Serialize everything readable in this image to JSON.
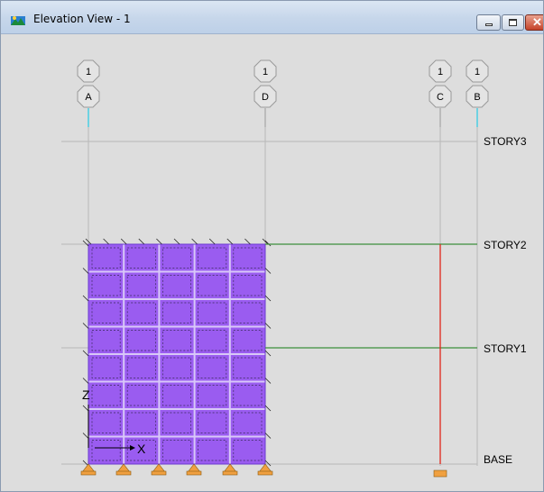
{
  "window": {
    "title": "Elevation View - 1",
    "controls": {
      "minimize": "minimize",
      "maximize": "maximize",
      "close": "close"
    }
  },
  "elevation": {
    "grids": [
      {
        "number": "1",
        "letter": "A"
      },
      {
        "number": "1",
        "letter": "D"
      },
      {
        "number": "1",
        "letter": "C"
      },
      {
        "number": "1",
        "letter": "B"
      }
    ],
    "stories": [
      "STORY3",
      "STORY2",
      "STORY1",
      "BASE"
    ],
    "axes": {
      "vertical": "Z",
      "horizontal": "X"
    },
    "colors": {
      "wall": "#9a5cf0",
      "beam": "#3c8f3c",
      "column": "#e0251a",
      "support": "#f0a040",
      "grid_line": "#b8b8b8",
      "bubble_stem": "#00c8e8"
    },
    "icons": [
      "app-icon",
      "minimize-icon",
      "maximize-icon",
      "close-icon",
      "support-icon"
    ]
  }
}
